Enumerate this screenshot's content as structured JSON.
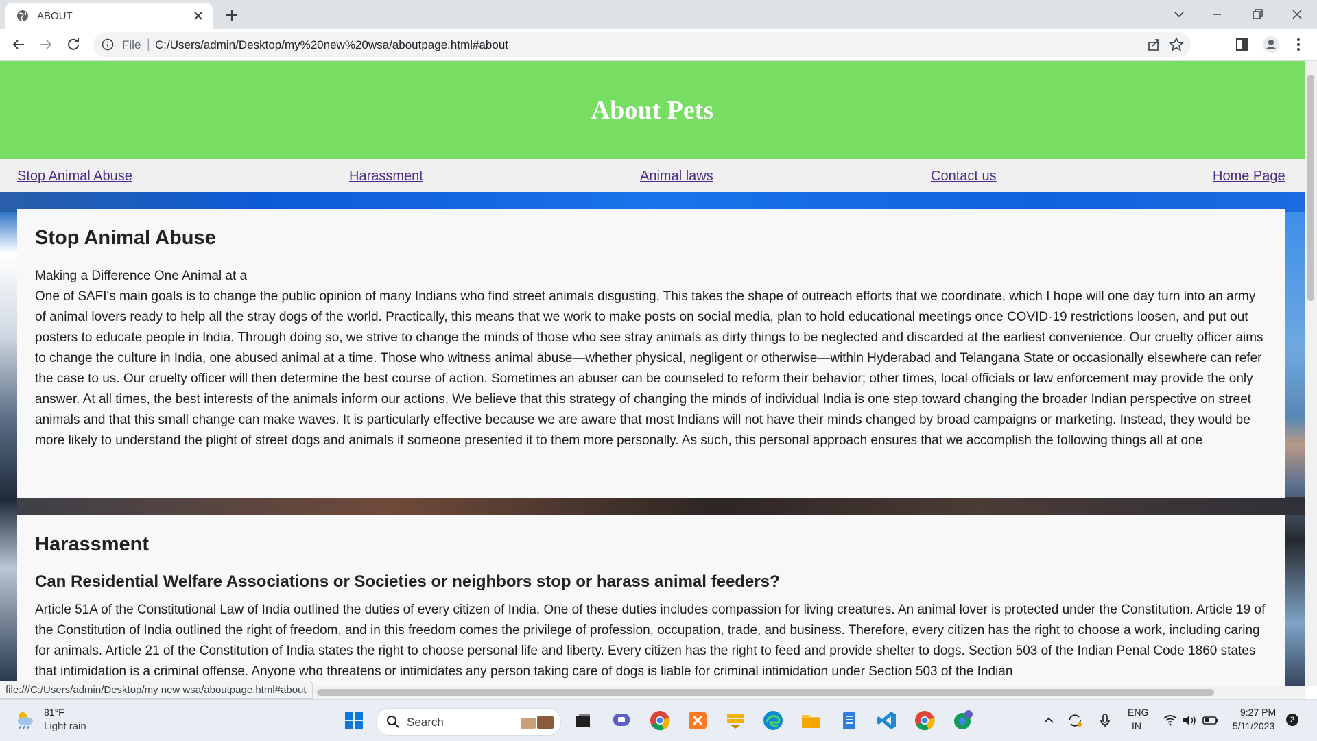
{
  "browser": {
    "tab_title": "ABOUT",
    "url_scheme": "File",
    "url": "C:/Users/admin/Desktop/my%20new%20wsa/aboutpage.html#about",
    "status_url": "file:///C:/Users/admin/Desktop/my new wsa/aboutpage.html#about"
  },
  "page": {
    "header_title": "About Pets",
    "nav": [
      "Stop Animal Abuse",
      "Harassment",
      "Animal laws",
      "Contact us",
      "Home Page"
    ],
    "section1": {
      "heading": "Stop Animal Abuse",
      "subtitle": "Making a Difference One Animal at a",
      "body": "One of SAFI's main goals is to change the public opinion of many Indians who find street animals disgusting. This takes the shape of outreach efforts that we coordinate, which I hope will one day turn into an army of animal lovers ready to help all the stray dogs of the world. Practically, this means that we work to make posts on social media, plan to hold educational meetings once COVID-19 restrictions loosen, and put out posters to educate people in India. Through doing so, we strive to change the minds of those who see stray animals as dirty things to be neglected and discarded at the earliest convenience. Our cruelty officer aims to change the culture in India, one abused animal at a time. Those who witness animal abuse—whether physical, negligent or otherwise—within Hyderabad and Telangana State or occasionally elsewhere can refer the case to us. Our cruelty officer will then determine the best course of action. Sometimes an abuser can be counseled to reform their behavior; other times, local officials or law enforcement may provide the only answer. At all times, the best interests of the animals inform our actions. We believe that this strategy of changing the minds of individual India is one step toward changing the broader Indian perspective on street animals and that this small change can make waves. It is particularly effective because we are aware that most Indians will not have their minds changed by broad campaigns or marketing. Instead, they would be more likely to understand the plight of street dogs and animals if someone presented it to them more personally. As such, this personal approach ensures that we accomplish the following things all at one"
    },
    "section2": {
      "heading": "Harassment",
      "subheading": "Can Residential Welfare Associations or Societies or neighbors stop or harass animal feeders?",
      "body": "Article 51A of the Constitutional Law of India outlined the duties of every citizen of India. One of these duties includes compassion for living creatures. An animal lover is protected under the Constitution. Article 19 of the Constitution of India outlined the right of freedom, and in this freedom comes the privilege of profession, occupation, trade, and business. Therefore, every citizen has the right to choose a work, including caring for animals. Article 21 of the Constitution of India states the right to choose personal life and liberty. Every citizen has the right to feed and provide shelter to dogs. Section 503 of the Indian Penal Code 1860 states that intimidation is a criminal offense. Anyone who threatens or intimidates any person taking care of dogs is liable for criminal intimidation under Section 503 of the Indian"
    }
  },
  "taskbar": {
    "weather_temp": "81°F",
    "weather_desc": "Light rain",
    "search_label": "Search",
    "lang_line1": "ENG",
    "lang_line2": "IN",
    "time": "9:27 PM",
    "date": "5/11/2023",
    "notification_count": "2"
  },
  "colors": {
    "header_green": "#77dd63",
    "nav_link": "#4b2a8a",
    "card_bg": "#f8f8f9"
  }
}
